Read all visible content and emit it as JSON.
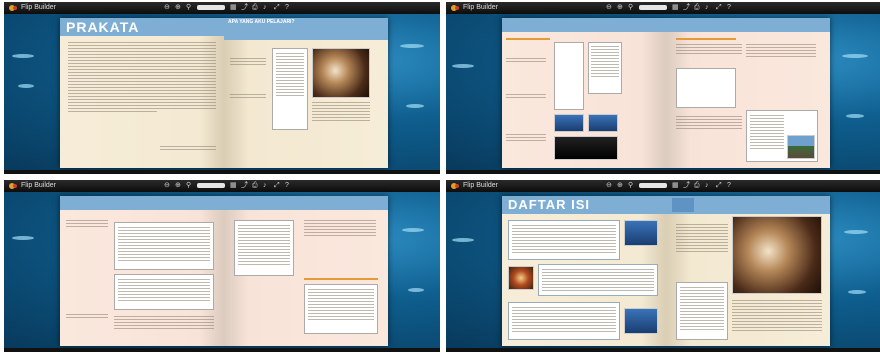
{
  "app": {
    "title": "Flip Builder"
  },
  "panes": [
    {
      "id": "pane-1",
      "left_page_title": "PRAKATA",
      "right_page_band": "APA YANG AKU PELAJARI?"
    },
    {
      "id": "pane-2"
    },
    {
      "id": "pane-3"
    },
    {
      "id": "pane-4",
      "left_page_title": "DAFTAR ISI"
    }
  ]
}
